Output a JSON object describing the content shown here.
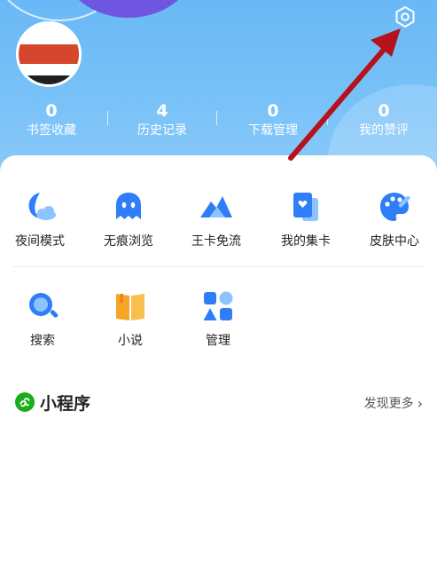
{
  "stats": [
    {
      "value": "0",
      "label": "书签收藏"
    },
    {
      "value": "4",
      "label": "历史记录"
    },
    {
      "value": "0",
      "label": "下载管理"
    },
    {
      "value": "0",
      "label": "我的赞评"
    }
  ],
  "features": [
    {
      "label": "夜间模式",
      "icon": "night-mode-icon"
    },
    {
      "label": "无痕浏览",
      "icon": "ghost-icon"
    },
    {
      "label": "王卡免流",
      "icon": "mountain-icon"
    },
    {
      "label": "我的集卡",
      "icon": "cards-icon"
    },
    {
      "label": "皮肤中心",
      "icon": "palette-icon"
    }
  ],
  "tools": [
    {
      "label": "搜索",
      "icon": "search-icon"
    },
    {
      "label": "小说",
      "icon": "book-icon"
    },
    {
      "label": "管理",
      "icon": "manage-icon"
    }
  ],
  "mini_programs": {
    "title": "小程序",
    "more_label": "发现更多"
  },
  "colors": {
    "header": "#79c2f8",
    "accent_blue": "#3a8dff",
    "mini_program_green": "#1aad19",
    "arrow_red": "#b5121b"
  }
}
